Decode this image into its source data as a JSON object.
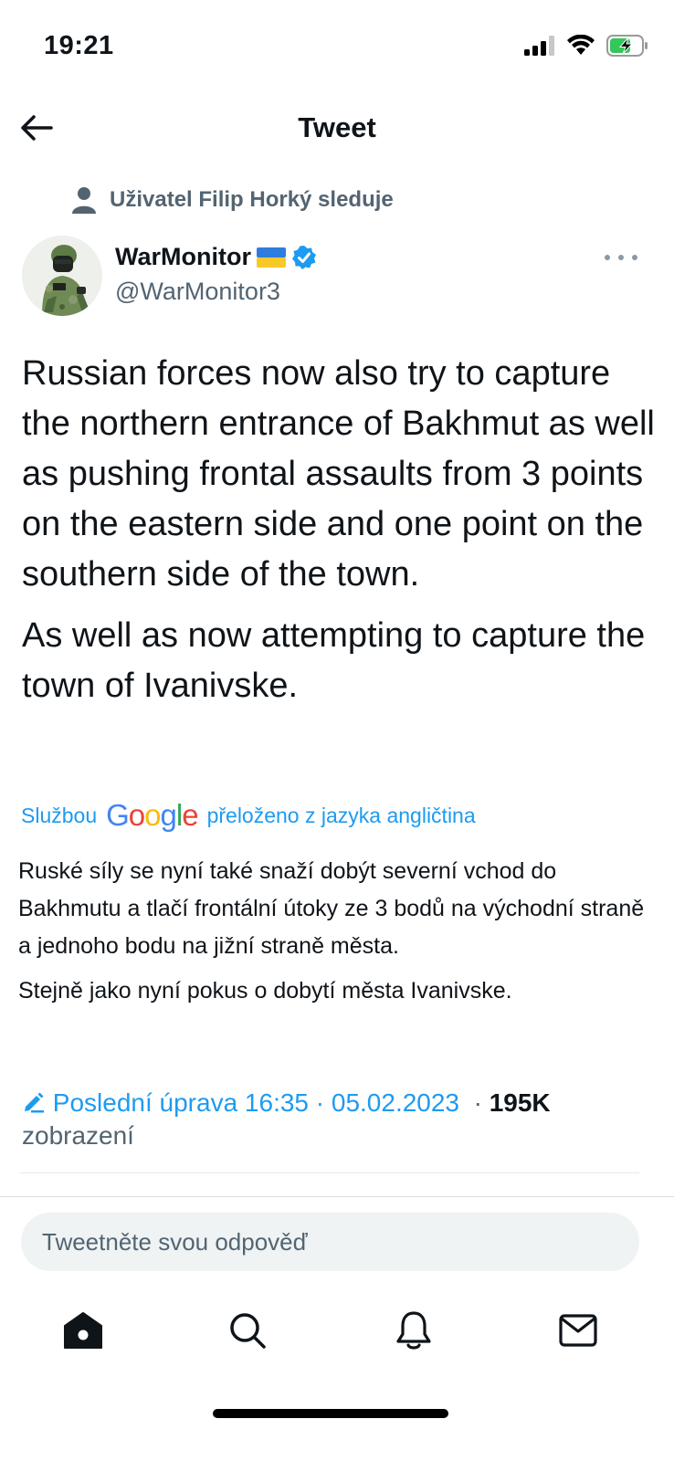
{
  "status_bar": {
    "time": "19:21"
  },
  "header": {
    "title": "Tweet"
  },
  "social_context": {
    "text": "Uživatel Filip Horký sleduje"
  },
  "author": {
    "name": "WarMonitor",
    "handle": "@WarMonitor3",
    "flag": "🇺🇦"
  },
  "tweet": {
    "paragraphs": [
      "Russian forces now also try to capture the northern entrance of Bakhmut as well as pushing frontal assaults from 3 points on the eastern side and one point on the southern side of the town.",
      "As well as now attempting to capture the town of Ivanivske."
    ]
  },
  "translation": {
    "prefix": "Službou",
    "brand": "Google",
    "suffix": "přeloženo z jazyka angličtina",
    "paragraphs": [
      "Ruské síly se nyní také snaží dobýt severní vchod do Bakhmutu a tlačí frontální útoky ze 3 bodů na východní straně a jednoho bodu na jižní straně města.",
      "Stejně jako nyní pokus o dobytí města Ivanivske."
    ]
  },
  "meta": {
    "edited_label": "Poslední úprava 16:35 · 05.02.2023",
    "separator": "·",
    "views": "195K",
    "views_label": "zobrazení"
  },
  "reply": {
    "placeholder": "Tweetněte svou odpověď"
  },
  "colors": {
    "accent": "#1d9bf0",
    "muted": "#536471",
    "text": "#0f1419"
  },
  "nav": {
    "items": [
      "home-icon",
      "search-icon",
      "bell-icon",
      "mail-icon"
    ]
  }
}
